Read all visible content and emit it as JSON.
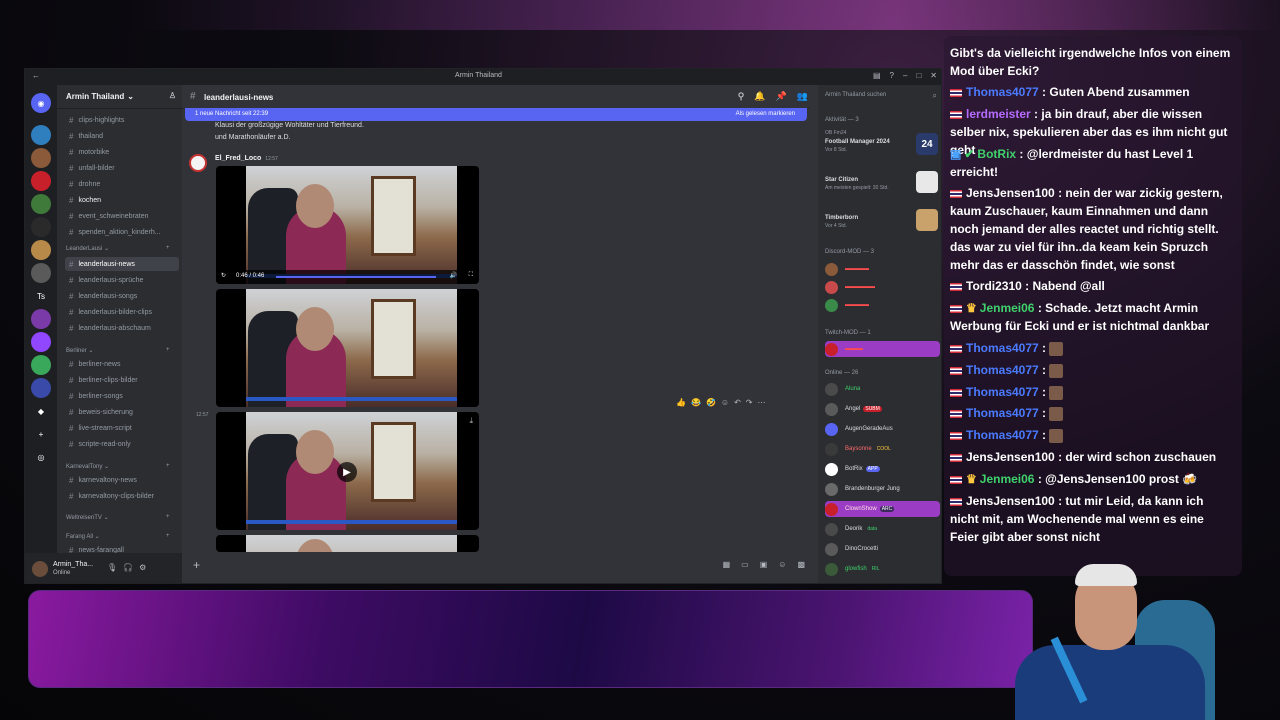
{
  "discord": {
    "window_title": "Armin Thailand",
    "guild_name": "Armin Thailand",
    "channels": [
      {
        "name": "clips-highlights"
      },
      {
        "name": "thailand"
      },
      {
        "name": "motorbike"
      },
      {
        "name": "unfall-bilder"
      },
      {
        "name": "drohne"
      },
      {
        "name": "kochen"
      },
      {
        "name": "event_schweinebraten"
      },
      {
        "name": "spenden_aktion_kinderh..."
      }
    ],
    "categories": {
      "leanderlausi": "LeanderLausi",
      "berliner": "Berliner",
      "karnevaltony": "KarnevalTony",
      "weltreisentv": "WeltreisenTV",
      "farang": "Farang All"
    },
    "leander_channels": [
      {
        "name": "leanderlausi-news"
      },
      {
        "name": "leanderlausi-sprüche"
      },
      {
        "name": "leanderlausi-songs"
      },
      {
        "name": "leanderlausi-bilder-clips"
      },
      {
        "name": "leanderlausi-abschaum"
      }
    ],
    "berliner_channels": [
      {
        "name": "berliner-news"
      },
      {
        "name": "berliner-clips-bilder"
      },
      {
        "name": "berliner-songs"
      },
      {
        "name": "beweis-sicherung"
      },
      {
        "name": "live-stream-script"
      },
      {
        "name": "scripte-read-only"
      }
    ],
    "karneval_channels": [
      {
        "name": "karnevaltony-news"
      },
      {
        "name": "karnevaltony-clips-bilder"
      }
    ],
    "farang_channels": [
      {
        "name": "news-farangall"
      }
    ],
    "current_channel": "leanderlausi-news",
    "new_message_bar": {
      "left": "1 neue Nachricht seit 22:39",
      "right": "Als gelesen markieren"
    },
    "previous_text_line1": "Klausi der großzügige Wohltäter und Tierfreund.",
    "previous_text_line2": "und Marathonläufer a.D.",
    "author": "El_Fred_Loco",
    "author_time": "12:57",
    "side_time": "12:57",
    "video_time": "0:46 / 0:46",
    "user": {
      "name": "Armin_Tha...",
      "status": "Online"
    },
    "member_search": "Armin Thailand suchen",
    "activity_header": "Aktivität — 3",
    "activities": [
      {
        "who": "OB Fm24",
        "game": "Football Manager 2024",
        "meta": "Vor 8 Std."
      },
      {
        "who": "",
        "game": "Star Citizen",
        "meta": "Am meisten gespielt: 30 Std."
      },
      {
        "who": "",
        "game": "Timberborn",
        "meta": "Vor 4 Std."
      }
    ],
    "discord_mod_header": "Discord-MOD — 3",
    "twitch_mod_header": "Twitch-MOD — 1",
    "online_header": "Online — 26",
    "online_members": [
      {
        "name": "Aluna",
        "color": "#3fd16b"
      },
      {
        "name": "Angel",
        "badge": "SUBM",
        "color": "#dbdee1"
      },
      {
        "name": "AugenGeradeAus",
        "color": "#dbdee1"
      },
      {
        "name": "Baysonne",
        "badge": "COOL",
        "color": "#dbdee1"
      },
      {
        "name": "BotRix",
        "badge": "APP",
        "color": "#dbdee1"
      },
      {
        "name": "Brandenburger Jung",
        "color": "#dbdee1"
      },
      {
        "name": "ClownShow",
        "badge": "ARC",
        "color": "#ff6b6b"
      },
      {
        "name": "Deorik",
        "badge": "data",
        "color": "#dbdee1"
      },
      {
        "name": "DinoCrocetti",
        "color": "#dbdee1"
      },
      {
        "name": "glowfish",
        "badge": "RIL",
        "color": "#3fd16b"
      }
    ]
  },
  "chat": {
    "messages": [
      {
        "user": "",
        "color": "#ffffff",
        "text": "Gibt's da vielleicht irgendwelche Infos von einem Mod über Ecki?"
      },
      {
        "user": "Thomas4077",
        "color": "#4a7bff",
        "text": ": Guten Abend zusammen"
      },
      {
        "user": "lerdmeister",
        "color": "#b56cff",
        "text": ": ja bin drauf, aber die wissen selber nix, spekulieren aber das es ihm nicht gut geht"
      },
      {
        "user": "BotRix",
        "color": "#3fd16b",
        "text": ": @lerdmeister du hast Level 1 erreicht!"
      },
      {
        "user": "JensJensen100",
        "color": "#ffffff",
        "text": ": nein der war zickig gestern, kaum Zuschauer, kaum Einnahmen und dann noch jemand der alles reactet und richtig stellt. das war zu viel für ihn..da keam kein Spruzch mehr das er dasschön findet, wie sonst"
      },
      {
        "user": "Tordi2310",
        "color": "#ffffff",
        "text": ": Nabend @all"
      },
      {
        "user": "Jenmei06",
        "color": "#3fd16b",
        "text": ": Schade. Jetzt macht Armin Werbung für Ecki und er ist nichtmal dankbar"
      },
      {
        "user": "Thomas4077",
        "color": "#4a7bff",
        "text": ":"
      },
      {
        "user": "Thomas4077",
        "color": "#4a7bff",
        "text": ":"
      },
      {
        "user": "Thomas4077",
        "color": "#4a7bff",
        "text": ":"
      },
      {
        "user": "Thomas4077",
        "color": "#4a7bff",
        "text": ":"
      },
      {
        "user": "Thomas4077",
        "color": "#4a7bff",
        "text": ":"
      },
      {
        "user": "JensJensen100",
        "color": "#ffffff",
        "text": ": der wird schon zuschauen"
      },
      {
        "user": "Jenmei06",
        "color": "#3fd16b",
        "text": ": @JensJensen100 prost"
      },
      {
        "user": "JensJensen100",
        "color": "#ffffff",
        "text": ": tut mir Leid, da kann ich nicht mit, am Wochenende mal wenn es eine Feier gibt aber sonst nicht"
      }
    ]
  }
}
